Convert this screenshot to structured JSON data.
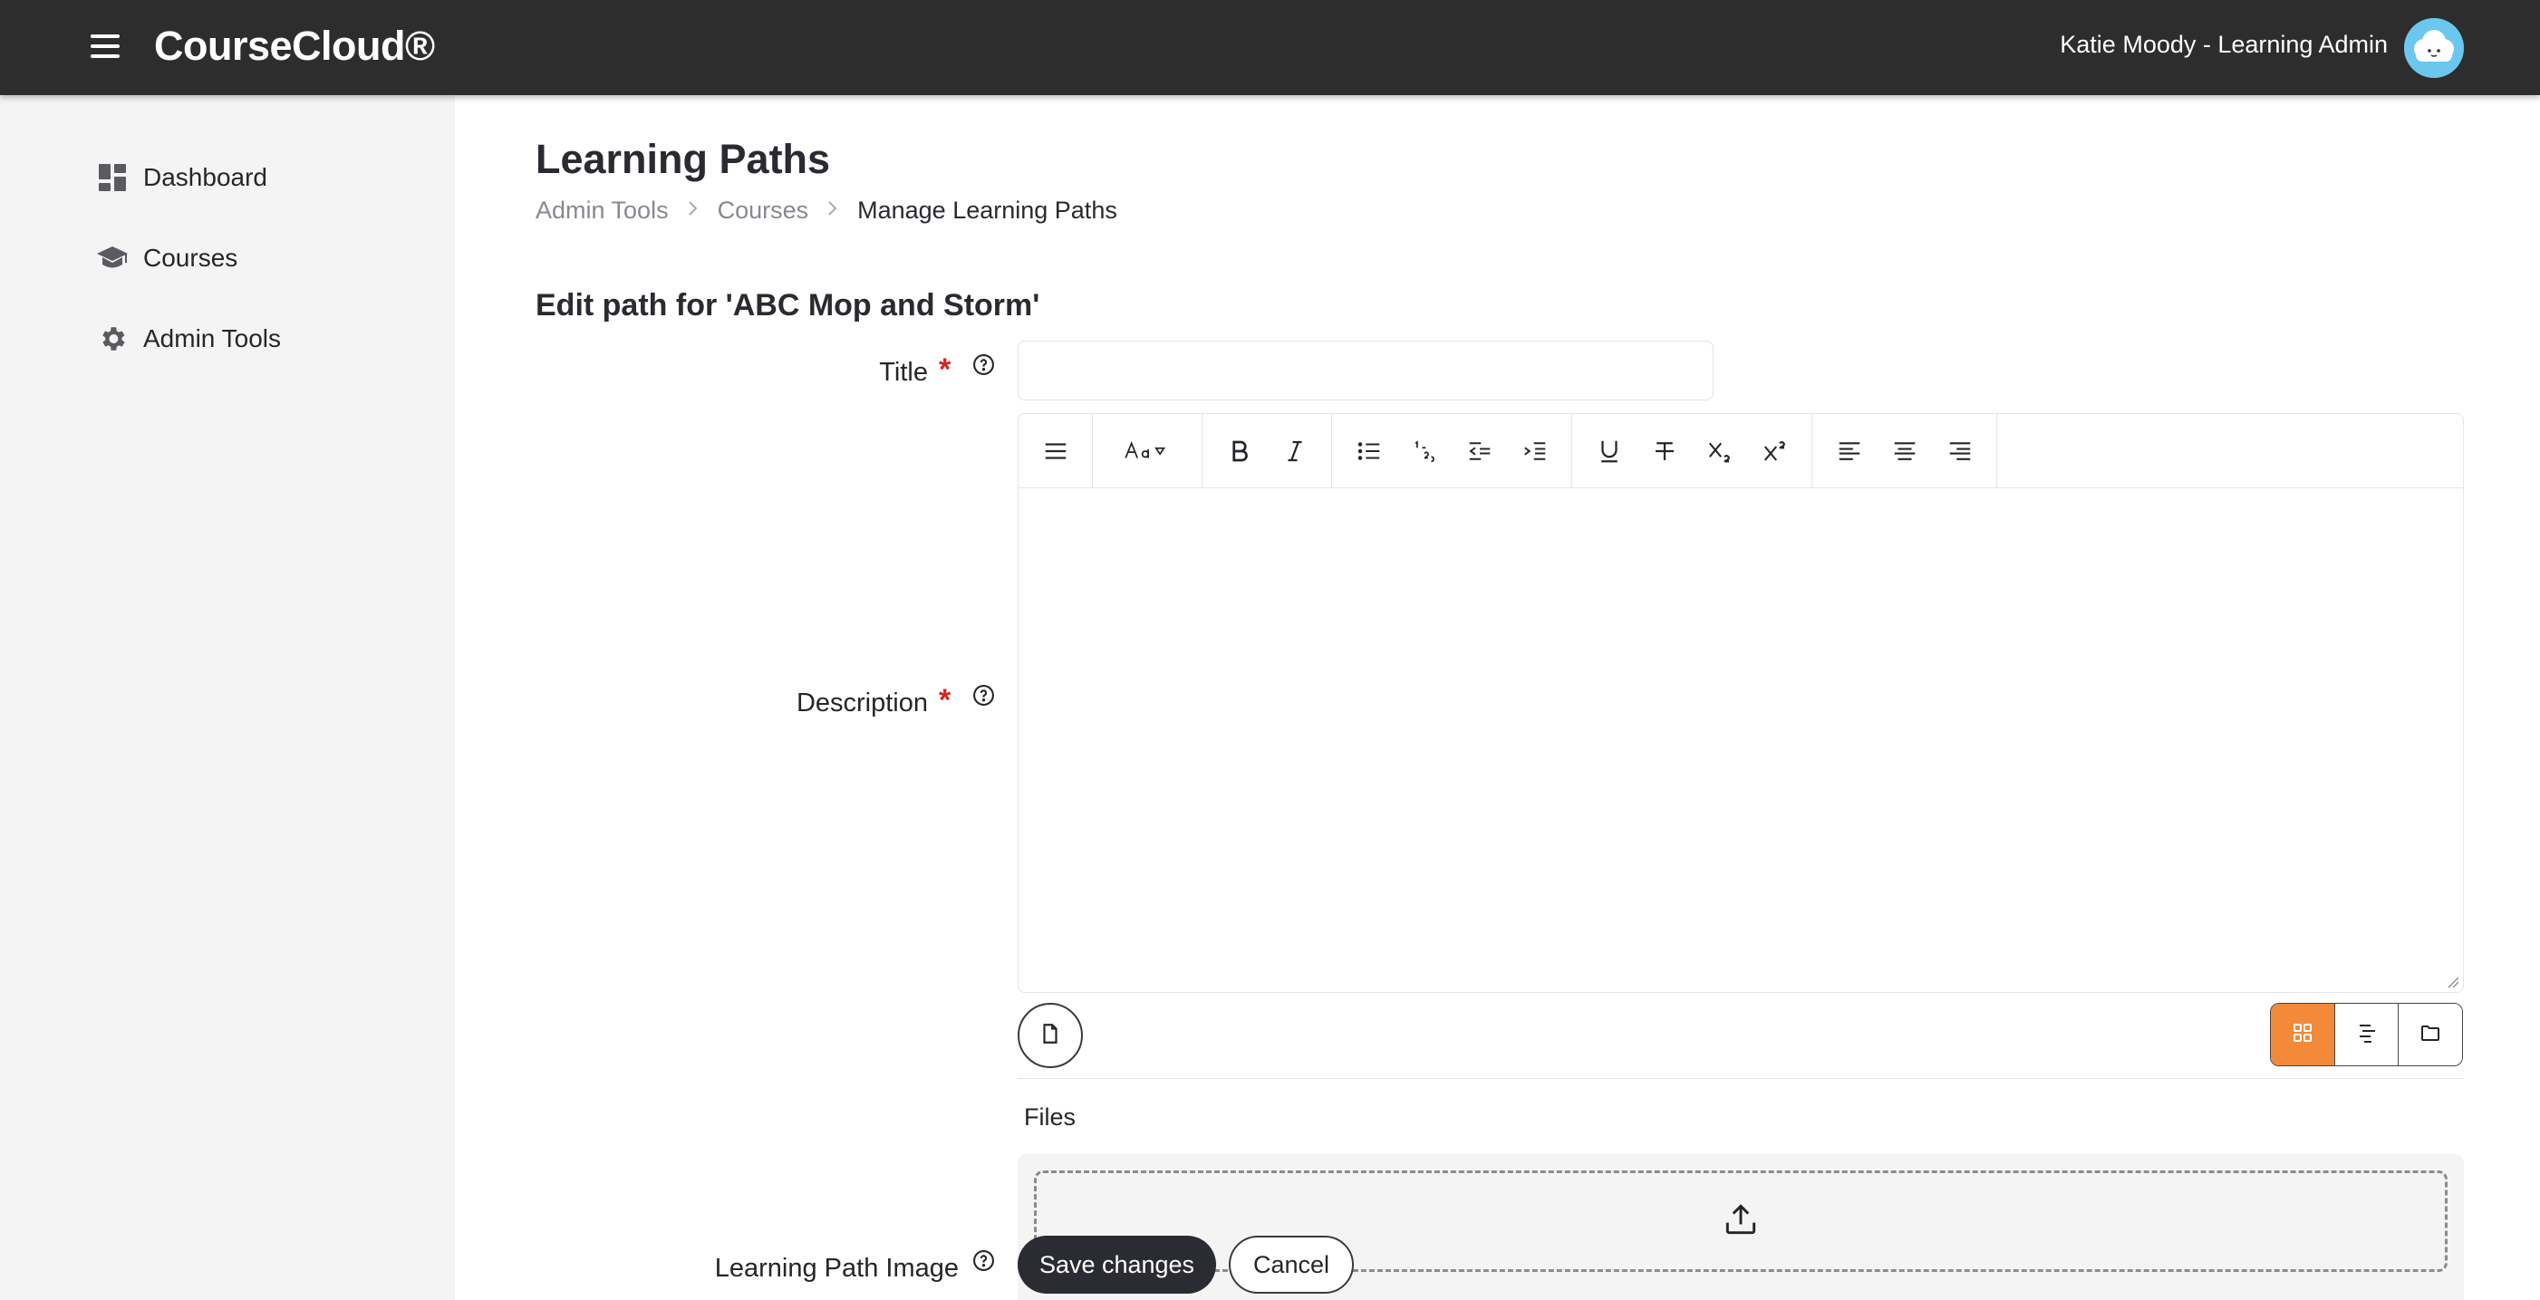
{
  "app": {
    "brand": "CourseCloud®",
    "user_label": "Katie Moody - Learning Admin"
  },
  "sidebar": {
    "items": [
      {
        "label": "Dashboard",
        "icon": "dashboard-icon"
      },
      {
        "label": "Courses",
        "icon": "graduation-cap-icon"
      },
      {
        "label": "Admin Tools",
        "icon": "gear-icon"
      }
    ]
  },
  "page": {
    "title": "Learning Paths",
    "breadcrumb": [
      "Admin Tools",
      "Courses",
      "Manage Learning Paths"
    ],
    "section_title": "Edit path for 'ABC Mop and Storm'"
  },
  "form": {
    "title_label": "Title",
    "title_value": "",
    "description_label": "Description",
    "description_value": "",
    "required_mark": "*",
    "files_label": "Files",
    "image_label": "Learning Path Image",
    "save_label": "Save changes",
    "cancel_label": "Cancel"
  },
  "toolbar": {
    "groups": [
      [
        "menu-icon"
      ],
      [
        "font-size-icon"
      ],
      [
        "bold-icon",
        "italic-icon"
      ],
      [
        "bullet-list-icon",
        "numbered-list-icon",
        "outdent-icon",
        "indent-icon"
      ],
      [
        "underline-icon",
        "strikethrough-icon",
        "subscript-icon",
        "superscript-icon"
      ],
      [
        "align-left-icon",
        "align-center-icon",
        "align-right-icon"
      ]
    ]
  },
  "view_toggle": {
    "options": [
      "grid-icon",
      "list-icon",
      "folder-icon"
    ],
    "active": "grid-icon"
  },
  "colors": {
    "topbar": "#2d2d2d",
    "sidebar": "#f4f4f4",
    "accent": "#f28a3a",
    "required": "#d9231f",
    "primary_button": "#2b2b33"
  }
}
